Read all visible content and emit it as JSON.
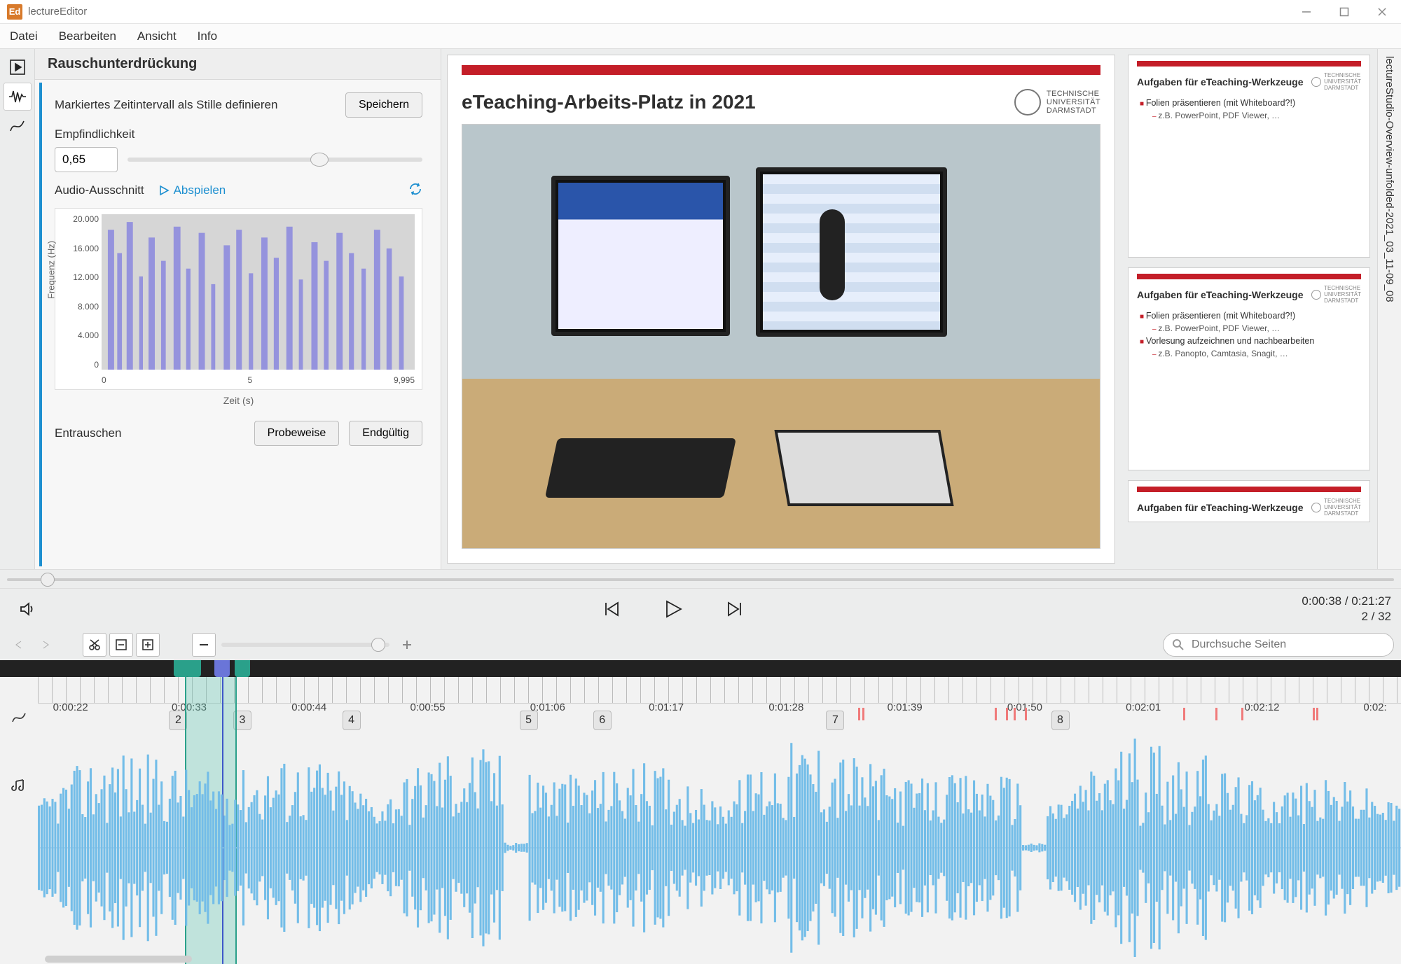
{
  "titlebar": {
    "app_short": "Ed",
    "app_title": "lectureEditor"
  },
  "menubar": [
    "Datei",
    "Bearbeiten",
    "Ansicht",
    "Info"
  ],
  "side_panel": {
    "header": "Rauschunterdrückung",
    "interval_label": "Markiertes Zeitintervall als Stille definieren",
    "save_btn": "Speichern",
    "sensitivity_label": "Empfindlichkeit",
    "sensitivity_value": "0,65",
    "clip_label": "Audio-Ausschnitt",
    "play_label": "Abspielen",
    "denoise_label": "Entrauschen",
    "preview_btn": "Probeweise",
    "final_btn": "Endgültig"
  },
  "chart_data": {
    "type": "heatmap",
    "title": "",
    "xlabel": "Zeit (s)",
    "ylabel": "Frequenz (Hz)",
    "xlim": [
      0,
      9.995
    ],
    "ylim": [
      0,
      20000
    ],
    "x_ticks": [
      "0",
      "5",
      "9,995"
    ],
    "y_ticks": [
      "20.000",
      "16.000",
      "12.000",
      "8.000",
      "4.000",
      "0"
    ]
  },
  "slide": {
    "title": "eTeaching-Arbeits-Platz in 2021",
    "uni": "TECHNISCHE\nUNIVERSITÄT\nDARMSTADT"
  },
  "thumbs": [
    {
      "title": "Aufgaben für eTeaching-Werkzeuge",
      "bullets": [
        {
          "lvl": 0,
          "text": "Folien präsentieren (mit Whiteboard?!)"
        },
        {
          "lvl": 1,
          "text": "z.B. PowerPoint, PDF Viewer, …"
        }
      ]
    },
    {
      "title": "Aufgaben für eTeaching-Werkzeuge",
      "bullets": [
        {
          "lvl": 0,
          "text": "Folien präsentieren (mit Whiteboard?!)"
        },
        {
          "lvl": 1,
          "text": "z.B. PowerPoint, PDF Viewer, …"
        },
        {
          "lvl": 0,
          "text": "Vorlesung aufzeichnen und nachbearbeiten"
        },
        {
          "lvl": 1,
          "text": "z.B. Panopto, Camtasia, Snagit, …"
        }
      ]
    },
    {
      "title": "Aufgaben für eTeaching-Werkzeuge",
      "bullets": []
    }
  ],
  "side_tab": "lectureStudio-Overview-unfolded-2021_03_11-09_08",
  "transport": {
    "time": "0:00:38 / 0:21:27",
    "pages": "2 / 32"
  },
  "search_placeholder": "Durchsuche Seiten",
  "timeline": {
    "labels": [
      "0:00:22",
      "0:00:33",
      "0:00:44",
      "0:00:55",
      "0:01:06",
      "0:01:17",
      "0:01:28",
      "0:01:39",
      "0:01:50",
      "0:02:01",
      "0:02:12",
      "0:02:"
    ],
    "label_positions_pct": [
      2.4,
      11.1,
      19.9,
      28.6,
      37.4,
      46.1,
      54.9,
      63.6,
      72.4,
      81.1,
      89.8,
      98.1
    ],
    "pages": [
      {
        "n": "2",
        "pos_pct": 10.3
      },
      {
        "n": "3",
        "pos_pct": 15.0
      },
      {
        "n": "4",
        "pos_pct": 23.0
      },
      {
        "n": "5",
        "pos_pct": 36.0
      },
      {
        "n": "6",
        "pos_pct": 41.4
      },
      {
        "n": "7",
        "pos_pct": 58.5
      },
      {
        "n": "8",
        "pos_pct": 75.0
      }
    ],
    "red_ticks_pct": [
      60.2,
      60.5,
      70.2,
      71.0,
      71.6,
      72.4,
      84.0,
      86.4,
      88.3,
      93.5,
      93.8
    ],
    "selection": {
      "start_pct": 10.8,
      "end_pct": 14.6
    },
    "playhead_pct": 13.5,
    "markers": [
      {
        "type": "green",
        "pos_pct": 10.0
      },
      {
        "type": "green",
        "pos_pct": 10.9
      },
      {
        "type": "blue",
        "pos_pct": 13.0
      },
      {
        "type": "green",
        "pos_pct": 14.5
      }
    ]
  }
}
